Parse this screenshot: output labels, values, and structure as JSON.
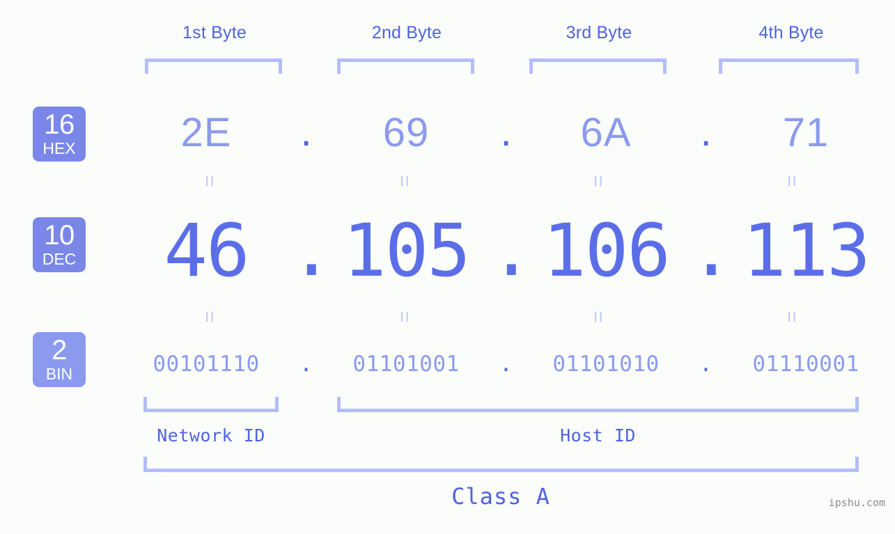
{
  "meta": {
    "watermark": "ipshu.com",
    "ip_address": "46.105.106.113",
    "ip_class": "Class A",
    "colors": {
      "background": "#fbfdfa",
      "badge_bg": "#7a87e8",
      "badge_bg_light": "#8b9aee",
      "accent_strong": "#4f63e0",
      "accent_light": "#8b9aee",
      "bracket": "#b4bdfb",
      "connector": "#c3caf8",
      "dec_text": "#5b6ee8",
      "watermark": "#8c8c8c"
    }
  },
  "byte_headers": [
    {
      "label": "1st Byte"
    },
    {
      "label": "2nd Byte"
    },
    {
      "label": "3rd Byte"
    },
    {
      "label": "4th Byte"
    }
  ],
  "rows": {
    "hex": {
      "badge_base": "16",
      "badge_name": "HEX",
      "separator": ".",
      "values": [
        "2E",
        "69",
        "6A",
        "71"
      ]
    },
    "dec": {
      "badge_base": "10",
      "badge_name": "DEC",
      "separator": ".",
      "values": [
        "46",
        "105",
        "106",
        "113"
      ]
    },
    "bin": {
      "badge_base": "2",
      "badge_name": "BIN",
      "separator": ".",
      "values": [
        "00101110",
        "01101001",
        "01101010",
        "01110001"
      ]
    }
  },
  "connectors": {
    "symbol": "="
  },
  "segments": {
    "network_id_label": "Network ID",
    "host_id_label": "Host ID",
    "class_label": "Class A"
  }
}
